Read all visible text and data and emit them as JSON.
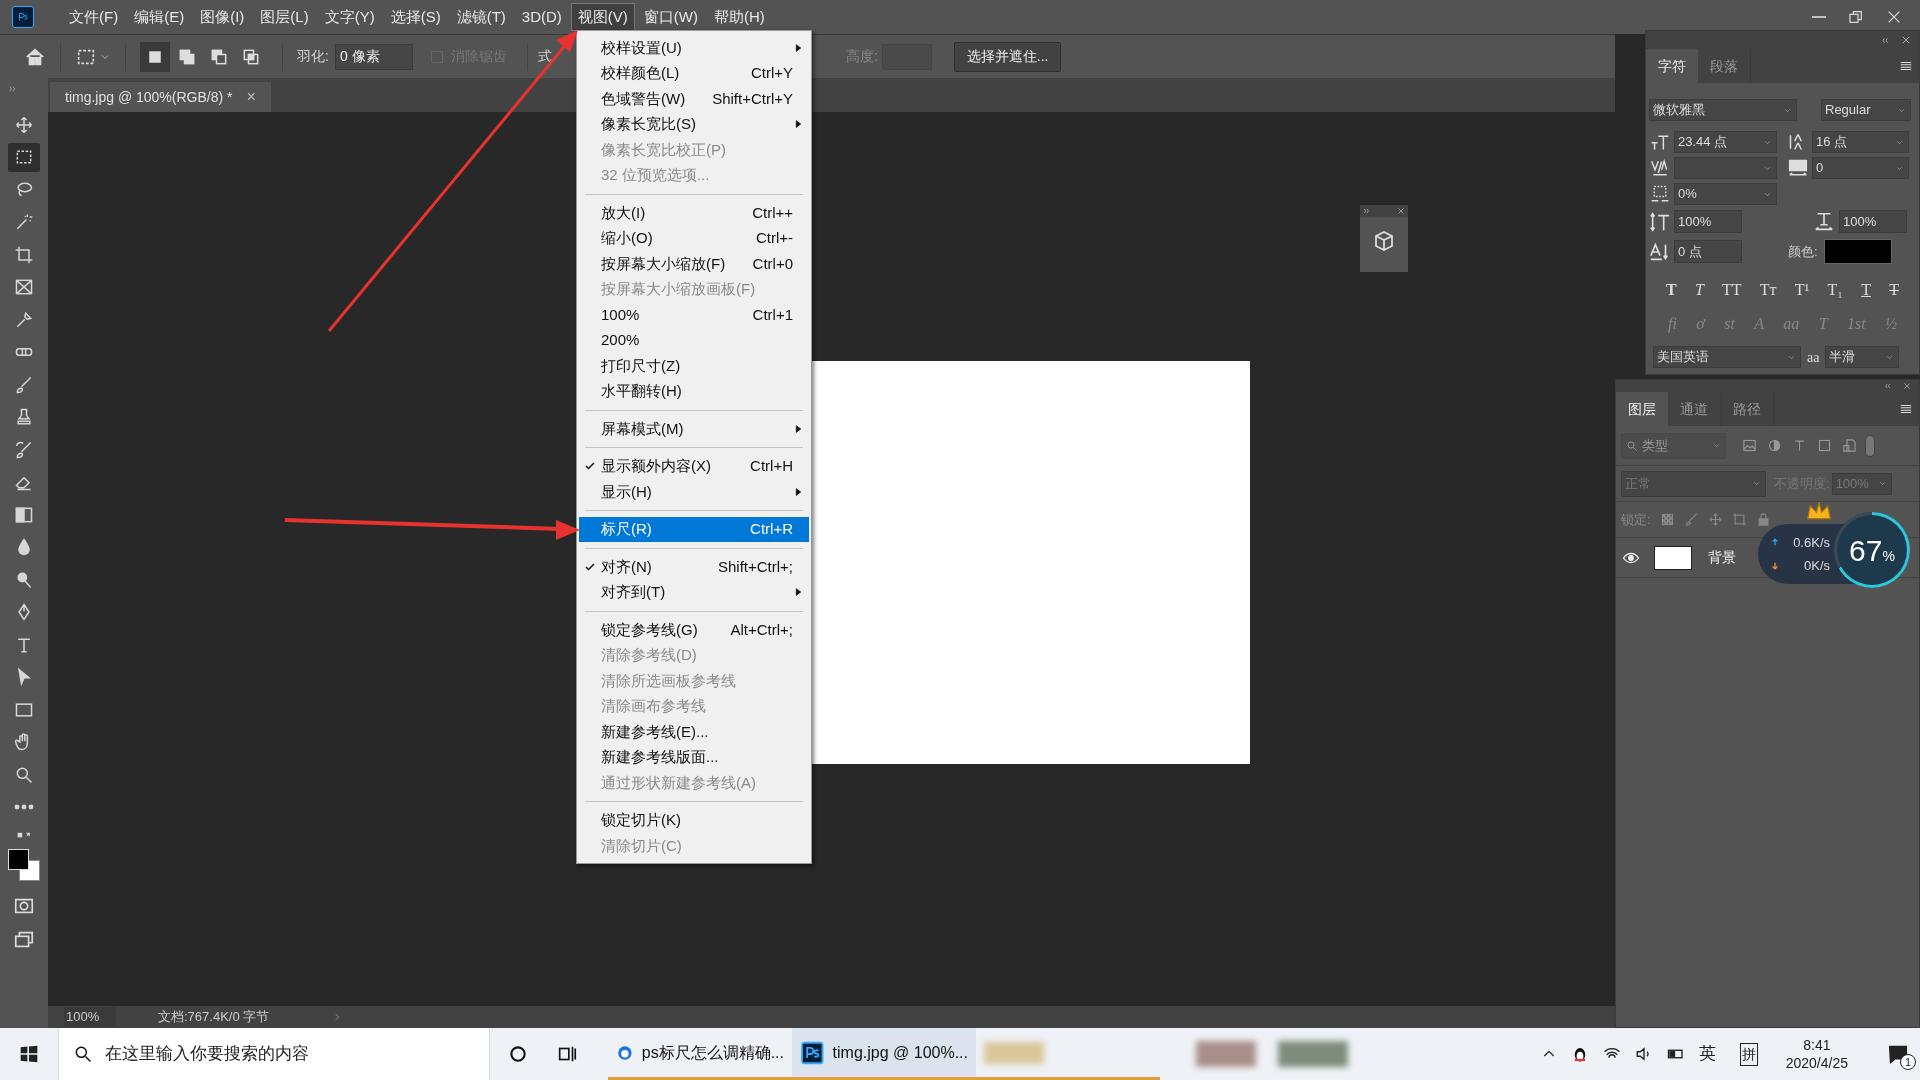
{
  "menubar": {
    "items": [
      {
        "label": "文件(F)",
        "selected": false
      },
      {
        "label": "编辑(E)",
        "selected": false
      },
      {
        "label": "图像(I)",
        "selected": false
      },
      {
        "label": "图层(L)",
        "selected": false
      },
      {
        "label": "文字(Y)",
        "selected": false
      },
      {
        "label": "选择(S)",
        "selected": false
      },
      {
        "label": "滤镜(T)",
        "selected": false
      },
      {
        "label": "3D(D)",
        "selected": false
      },
      {
        "label": "视图(V)",
        "selected": true
      },
      {
        "label": "窗口(W)",
        "selected": false
      },
      {
        "label": "帮助(H)",
        "selected": false
      }
    ]
  },
  "options_bar": {
    "modes": [
      {
        "selected": true
      },
      {
        "selected": false
      },
      {
        "selected": false
      },
      {
        "selected": false
      }
    ],
    "feather_label": "羽化:",
    "feather_value": "0 像素",
    "antialias_label": "消除锯齿",
    "antialias_checked": false,
    "style_label": "式",
    "height_label": "高度:",
    "select_mask_button": "选择并遮住..."
  },
  "document_tab": {
    "title": "timg.jpg @ 100%(RGB/8) *",
    "close": "×"
  },
  "tools": [
    {
      "kind": "move",
      "selected": false
    },
    {
      "kind": "marquee",
      "selected": true
    },
    {
      "kind": "lasso",
      "selected": false
    },
    {
      "kind": "wand",
      "selected": false
    },
    {
      "kind": "crop",
      "selected": false
    },
    {
      "kind": "frame",
      "selected": false
    },
    {
      "kind": "eyedropper",
      "selected": false
    },
    {
      "kind": "patch",
      "selected": false
    },
    {
      "kind": "brush",
      "selected": false
    },
    {
      "kind": "stamp",
      "selected": false
    },
    {
      "kind": "history",
      "selected": false
    },
    {
      "kind": "eraser",
      "selected": false
    },
    {
      "kind": "gradient",
      "selected": false
    },
    {
      "kind": "drop",
      "selected": false
    },
    {
      "kind": "dodge",
      "selected": false
    },
    {
      "kind": "pen",
      "selected": false
    },
    {
      "kind": "type",
      "selected": false
    },
    {
      "kind": "pointer",
      "selected": false
    },
    {
      "kind": "rect",
      "selected": false
    },
    {
      "kind": "hand",
      "selected": false
    },
    {
      "kind": "zoom",
      "selected": false
    },
    {
      "kind": "more",
      "selected": false
    }
  ],
  "view_menu": [
    {
      "kind": "item",
      "label": "校样设置(U)",
      "submenu": true,
      "disabled": false,
      "checked": false,
      "selected": false
    },
    {
      "kind": "item",
      "label": "校样颜色(L)",
      "shortcut": "Ctrl+Y",
      "submenu": false,
      "disabled": false,
      "checked": false,
      "selected": false
    },
    {
      "kind": "item",
      "label": "色域警告(W)",
      "shortcut": "Shift+Ctrl+Y",
      "submenu": false,
      "disabled": false,
      "checked": false,
      "selected": false
    },
    {
      "kind": "item",
      "label": "像素长宽比(S)",
      "submenu": true,
      "disabled": false,
      "checked": false,
      "selected": false
    },
    {
      "kind": "item",
      "label": "像素长宽比校正(P)",
      "submenu": false,
      "disabled": true,
      "checked": false,
      "selected": false
    },
    {
      "kind": "item",
      "label": "32 位预览选项...",
      "submenu": false,
      "disabled": true,
      "checked": false,
      "selected": false
    },
    {
      "kind": "separator"
    },
    {
      "kind": "item",
      "label": "放大(I)",
      "shortcut": "Ctrl++",
      "submenu": false,
      "disabled": false,
      "checked": false,
      "selected": false
    },
    {
      "kind": "item",
      "label": "缩小(O)",
      "shortcut": "Ctrl+-",
      "submenu": false,
      "disabled": false,
      "checked": false,
      "selected": false
    },
    {
      "kind": "item",
      "label": "按屏幕大小缩放(F)",
      "shortcut": "Ctrl+0",
      "submenu": false,
      "disabled": false,
      "checked": false,
      "selected": false
    },
    {
      "kind": "item",
      "label": "按屏幕大小缩放画板(F)",
      "submenu": false,
      "disabled": true,
      "checked": false,
      "selected": false
    },
    {
      "kind": "item",
      "label": "100%",
      "shortcut": "Ctrl+1",
      "submenu": false,
      "disabled": false,
      "checked": false,
      "selected": false
    },
    {
      "kind": "item",
      "label": "200%",
      "submenu": false,
      "disabled": false,
      "checked": false,
      "selected": false
    },
    {
      "kind": "item",
      "label": "打印尺寸(Z)",
      "submenu": false,
      "disabled": false,
      "checked": false,
      "selected": false
    },
    {
      "kind": "item",
      "label": "水平翻转(H)",
      "submenu": false,
      "disabled": false,
      "checked": false,
      "selected": false
    },
    {
      "kind": "separator"
    },
    {
      "kind": "item",
      "label": "屏幕模式(M)",
      "submenu": true,
      "disabled": false,
      "checked": false,
      "selected": false
    },
    {
      "kind": "separator"
    },
    {
      "kind": "item",
      "label": "显示额外内容(X)",
      "shortcut": "Ctrl+H",
      "submenu": false,
      "disabled": false,
      "checked": true,
      "selected": false
    },
    {
      "kind": "item",
      "label": "显示(H)",
      "submenu": true,
      "disabled": false,
      "checked": false,
      "selected": false
    },
    {
      "kind": "separator"
    },
    {
      "kind": "item",
      "label": "标尺(R)",
      "shortcut": "Ctrl+R",
      "submenu": false,
      "disabled": false,
      "checked": false,
      "selected": true
    },
    {
      "kind": "separator"
    },
    {
      "kind": "item",
      "label": "对齐(N)",
      "shortcut": "Shift+Ctrl+;",
      "submenu": false,
      "disabled": false,
      "checked": true,
      "selected": false
    },
    {
      "kind": "item",
      "label": "对齐到(T)",
      "submenu": true,
      "disabled": false,
      "checked": false,
      "selected": false
    },
    {
      "kind": "separator"
    },
    {
      "kind": "item",
      "label": "锁定参考线(G)",
      "shortcut": "Alt+Ctrl+;",
      "submenu": false,
      "disabled": false,
      "checked": false,
      "selected": false
    },
    {
      "kind": "item",
      "label": "清除参考线(D)",
      "submenu": false,
      "disabled": true,
      "checked": false,
      "selected": false
    },
    {
      "kind": "item",
      "label": "清除所选画板参考线",
      "submenu": false,
      "disabled": true,
      "checked": false,
      "selected": false
    },
    {
      "kind": "item",
      "label": "清除画布参考线",
      "submenu": false,
      "disabled": true,
      "checked": false,
      "selected": false
    },
    {
      "kind": "item",
      "label": "新建参考线(E)...",
      "submenu": false,
      "disabled": false,
      "checked": false,
      "selected": false
    },
    {
      "kind": "item",
      "label": "新建参考线版面...",
      "submenu": false,
      "disabled": false,
      "checked": false,
      "selected": false
    },
    {
      "kind": "item",
      "label": "通过形状新建参考线(A)",
      "submenu": false,
      "disabled": true,
      "checked": false,
      "selected": false
    },
    {
      "kind": "separator"
    },
    {
      "kind": "item",
      "label": "锁定切片(K)",
      "submenu": false,
      "disabled": false,
      "checked": false,
      "selected": false
    },
    {
      "kind": "item",
      "label": "清除切片(C)",
      "submenu": false,
      "disabled": true,
      "checked": false,
      "selected": false
    }
  ],
  "character_panel": {
    "tabs": [
      {
        "label": "字符",
        "selected": true
      },
      {
        "label": "段落",
        "selected": false
      }
    ],
    "font_family": "微软雅黑",
    "font_style": "Regular",
    "size": "23.44 点",
    "leading": "16 点",
    "tracking": "0",
    "tsume": "0%",
    "vertical_scale": "100%",
    "horizontal_scale": "100%",
    "baseline_shift": "0 点",
    "color_label": "颜色:",
    "color": "#000000",
    "style_buttons": [
      {
        "label": "T",
        "kind": "bold"
      },
      {
        "label": "T",
        "kind": "italic"
      },
      {
        "label": "TT",
        "kind": "plain"
      },
      {
        "label": "Tт",
        "kind": "plain"
      },
      {
        "label": "T¹",
        "kind": "plain"
      },
      {
        "label": "T₁",
        "kind": "plain"
      },
      {
        "label": "T",
        "kind": "underline"
      },
      {
        "label": "T",
        "kind": "strike"
      }
    ],
    "opentype_buttons": [
      "fi",
      "ơ",
      "st",
      "A",
      "aa",
      "T",
      "1st",
      "½"
    ],
    "language": "美国英语",
    "antialias_icon": "aa",
    "antialias": "半滑"
  },
  "layers_panel": {
    "tabs": [
      {
        "label": "图层",
        "selected": true
      },
      {
        "label": "通道",
        "selected": false
      },
      {
        "label": "路径",
        "selected": false
      }
    ],
    "filter_placeholder": "类型",
    "blend_mode": "正常",
    "opacity_label": "不透明度:",
    "opacity": "100%",
    "lock_label": "锁定:",
    "layers": [
      {
        "name": "背景",
        "visible": true
      }
    ]
  },
  "speed_widget": {
    "upload": "0.6K/s",
    "download": "0K/s",
    "percent": "67",
    "percent_unit": "%"
  },
  "status_bar": {
    "zoom": "100%",
    "doc_info": "文档:767.4K/0 字节"
  },
  "taskbar": {
    "search_placeholder": "在这里输入你要搜索的内容",
    "apps": [
      {
        "kind": "browser",
        "label": "ps标尺怎么调精确...",
        "active": false
      },
      {
        "kind": "photoshop",
        "label": "timg.jpg @ 100%...",
        "active": true
      }
    ],
    "ime_lang": "英",
    "ime_mode": "拼",
    "time": "8:41",
    "date": "2020/4/25",
    "notifications": "1"
  }
}
